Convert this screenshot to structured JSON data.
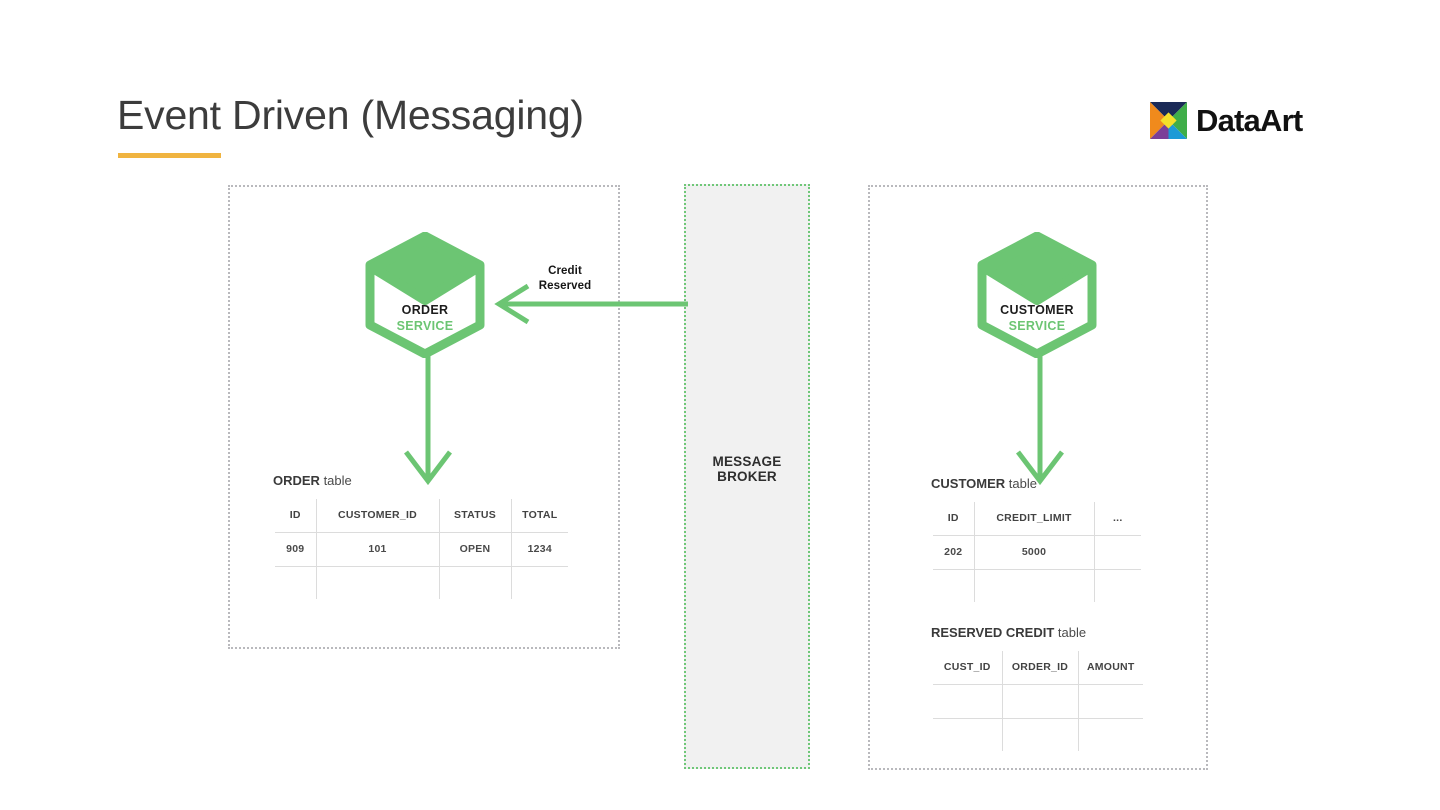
{
  "header": {
    "title": "Event Driven (Messaging)",
    "accent_color": "#f0b440",
    "logo_text": "DataArt"
  },
  "theme": {
    "service_green": "#6cc573",
    "arrow_green": "#6cc573",
    "broker_fill": "#f1f1f1",
    "zone_border": "#b9b9bd",
    "table_border": "#6b6b6b"
  },
  "zones": {
    "order": {
      "name": "ORDER SERVICE zone"
    },
    "customer": {
      "name": "CUSTOMER SERVICE zone"
    }
  },
  "services": {
    "order": {
      "name": "ORDER",
      "kind": "SERVICE"
    },
    "customer": {
      "name": "CUSTOMER",
      "kind": "SERVICE"
    }
  },
  "broker": {
    "line1": "MESSAGE",
    "line2": "BROKER"
  },
  "messages": {
    "credit_reserved": {
      "line1": "Credit",
      "line2": "Reserved"
    }
  },
  "tables": {
    "order": {
      "caption_strong": "ORDER",
      "caption_rest": " table",
      "columns": [
        "ID",
        "CUSTOMER_ID",
        "STATUS",
        "TOTAL"
      ],
      "rows": [
        [
          "909",
          "101",
          "OPEN",
          "1234"
        ],
        [
          "",
          "",
          "",
          ""
        ]
      ]
    },
    "customer": {
      "caption_strong": "CUSTOMER",
      "caption_rest": " table",
      "columns": [
        "ID",
        "CREDIT_LIMIT",
        "..."
      ],
      "rows": [
        [
          "202",
          "5000",
          ""
        ],
        [
          "",
          "",
          ""
        ]
      ]
    },
    "reserved_credit": {
      "caption_strong": "RESERVED  CREDIT",
      "caption_rest": " table",
      "columns": [
        "CUST_ID",
        "ORDER_ID",
        "AMOUNT"
      ],
      "rows": [
        [
          "",
          "",
          ""
        ],
        [
          "",
          "",
          ""
        ]
      ]
    }
  }
}
